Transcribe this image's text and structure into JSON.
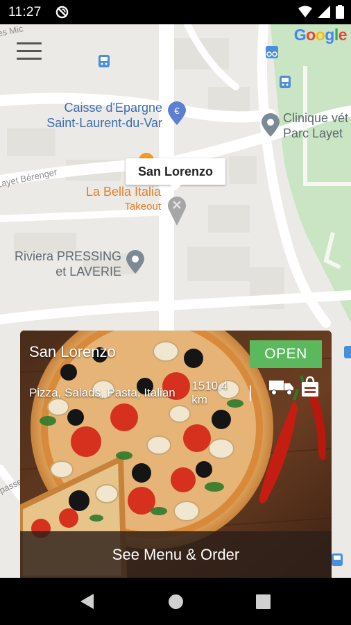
{
  "status_bar": {
    "time": "11:27"
  },
  "map": {
    "logo": [
      "G",
      "o",
      "o",
      "g",
      "l",
      "e"
    ],
    "logo_colors": [
      "#4285F4",
      "#EA4335",
      "#FBBC05",
      "#4285F4",
      "#34A853",
      "#EA4335"
    ],
    "pois": {
      "caisse_line1": "Caisse d'Epargne",
      "caisse_line2": "Saint-Laurent-du-Var",
      "clinique_line1": "Clinique vét",
      "clinique_line2": "Parc Layet",
      "bella_name": "La Bella Italia",
      "bella_sub": "Takeout",
      "pressing_line1": "Riviera PRESSING",
      "pressing_line2": "et LAVERIE"
    },
    "roads": {
      "layet": "Layet Bérenger",
      "top": "es Mic",
      "bottom": "passe"
    },
    "marker_label": "San Lorenzo"
  },
  "card": {
    "name": "San Lorenzo",
    "status": "OPEN",
    "categories": "Pizza, Salads, Pasta, Italian",
    "distance": "1510.4 km",
    "cta": "See Menu & Order",
    "accent": "#5cb85c"
  },
  "icons": [
    "dnd-icon",
    "wifi-icon",
    "signal-icon",
    "battery-icon",
    "menu-icon",
    "euro-pin-icon",
    "location-pin-icon",
    "restaurant-pin-icon",
    "bus-icon",
    "bike-icon",
    "delivery-truck-icon",
    "takeout-bag-icon",
    "back-icon",
    "home-icon",
    "recents-icon"
  ]
}
